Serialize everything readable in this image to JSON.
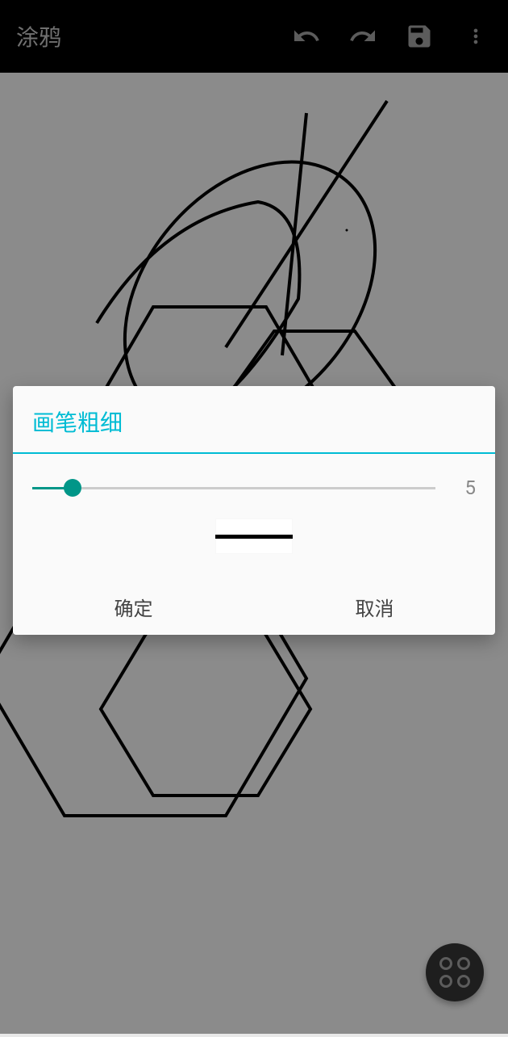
{
  "appBar": {
    "title": "涂鸦"
  },
  "dialog": {
    "title": "画笔粗细",
    "sliderValue": "5",
    "confirmLabel": "确定",
    "cancelLabel": "取消"
  },
  "colors": {
    "accent": "#00bcd4",
    "sliderAccent": "#009688"
  }
}
